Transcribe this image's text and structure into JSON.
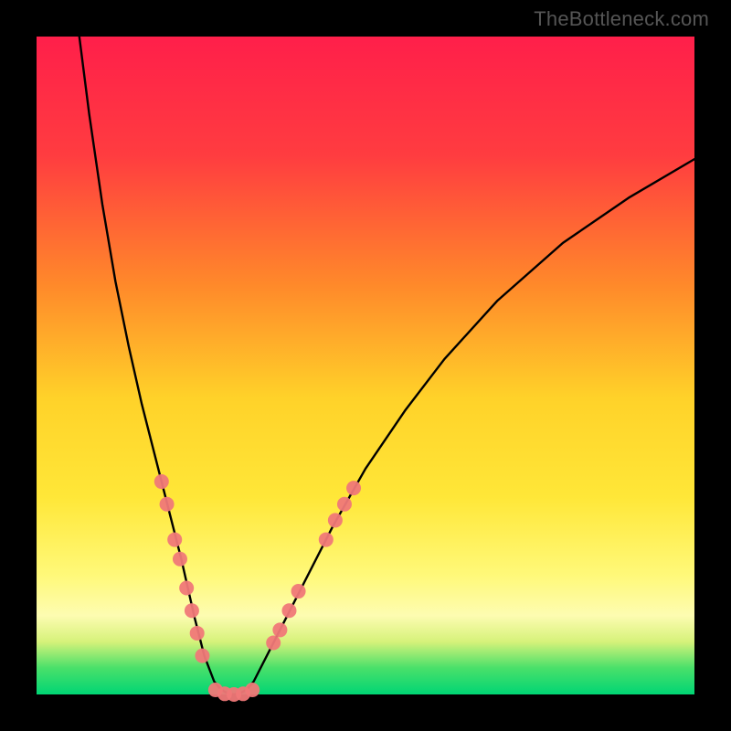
{
  "watermark": {
    "text": "TheBottleneck.com",
    "color": "#555555"
  },
  "chart_data": {
    "type": "line",
    "title": "",
    "xlabel": "",
    "ylabel": "",
    "xlim": [
      0,
      100
    ],
    "ylim": [
      -2,
      100
    ],
    "grid": false,
    "legend": false,
    "gradient_stops": [
      {
        "offset": 0,
        "color": "#ff1f4a"
      },
      {
        "offset": 18,
        "color": "#ff3c40"
      },
      {
        "offset": 38,
        "color": "#ff8a2a"
      },
      {
        "offset": 55,
        "color": "#ffd229"
      },
      {
        "offset": 70,
        "color": "#ffe738"
      },
      {
        "offset": 82,
        "color": "#fff97a"
      },
      {
        "offset": 88,
        "color": "#fdfcb1"
      },
      {
        "offset": 92,
        "color": "#d6f27a"
      },
      {
        "offset": 96,
        "color": "#49e06a"
      },
      {
        "offset": 100,
        "color": "#00d574"
      }
    ],
    "series": [
      {
        "name": "left-branch",
        "stroke": "#000000",
        "x": [
          6.5,
          8,
          10,
          12,
          14,
          16,
          18,
          20,
          22,
          24,
          25.5,
          27
        ],
        "y": [
          100,
          88,
          74,
          62,
          52,
          43,
          35,
          27,
          19,
          10,
          4,
          0
        ]
      },
      {
        "name": "valley-floor",
        "stroke": "#000000",
        "x": [
          27,
          28,
          29,
          30,
          31,
          32,
          33
        ],
        "y": [
          0,
          -1.2,
          -1.8,
          -2,
          -1.8,
          -1.2,
          0
        ]
      },
      {
        "name": "right-branch",
        "stroke": "#000000",
        "x": [
          33,
          36,
          40,
          45,
          50,
          56,
          62,
          70,
          80,
          90,
          100
        ],
        "y": [
          0,
          6,
          14,
          24,
          33,
          42,
          50,
          59,
          68,
          75,
          81
        ]
      }
    ],
    "markers": {
      "color": "#f07878",
      "radius_px": 8,
      "points": [
        {
          "x": 19.0,
          "y": 31
        },
        {
          "x": 19.8,
          "y": 27.5
        },
        {
          "x": 21.0,
          "y": 22
        },
        {
          "x": 21.8,
          "y": 19
        },
        {
          "x": 22.8,
          "y": 14.5
        },
        {
          "x": 23.6,
          "y": 11
        },
        {
          "x": 24.4,
          "y": 7.5
        },
        {
          "x": 25.2,
          "y": 4
        },
        {
          "x": 27.2,
          "y": -1.3
        },
        {
          "x": 28.6,
          "y": -1.9
        },
        {
          "x": 30.0,
          "y": -2.0
        },
        {
          "x": 31.4,
          "y": -1.9
        },
        {
          "x": 32.8,
          "y": -1.3
        },
        {
          "x": 36.0,
          "y": 6
        },
        {
          "x": 37.0,
          "y": 8
        },
        {
          "x": 38.4,
          "y": 11
        },
        {
          "x": 39.8,
          "y": 14
        },
        {
          "x": 44.0,
          "y": 22
        },
        {
          "x": 45.4,
          "y": 25
        },
        {
          "x": 46.8,
          "y": 27.5
        },
        {
          "x": 48.2,
          "y": 30
        }
      ]
    }
  }
}
